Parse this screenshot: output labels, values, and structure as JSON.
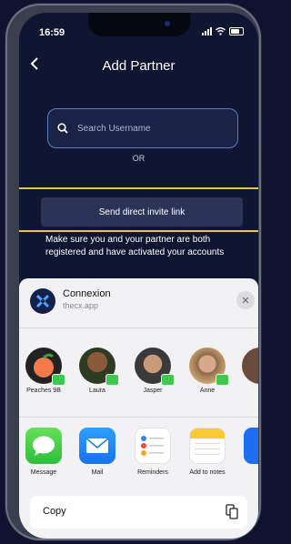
{
  "status": {
    "time": "16:59"
  },
  "header": {
    "title": "Add Partner"
  },
  "search": {
    "placeholder": "Search Username"
  },
  "divider_text": "OR",
  "invite": {
    "button_label": "Send direct invite link"
  },
  "info_text": "Make sure you and your partner are both registered and have activated your accounts",
  "share_sheet": {
    "app_name": "Connexion",
    "app_url": "thecx.app",
    "close_icon": "close-icon",
    "contacts": [
      {
        "name": "Peaches 9B",
        "icon": "peach-emoji-avatar"
      },
      {
        "name": "Laura",
        "icon": "contact-photo"
      },
      {
        "name": "Jasper",
        "icon": "contact-photo"
      },
      {
        "name": "Anne",
        "icon": "contact-photo"
      }
    ],
    "apps": [
      {
        "label": "Message",
        "icon": "messages-icon"
      },
      {
        "label": "Mail",
        "icon": "mail-icon"
      },
      {
        "label": "Reminders",
        "icon": "reminders-icon"
      },
      {
        "label": "Add to notes",
        "icon": "notes-icon"
      }
    ],
    "copy_label": "Copy"
  },
  "colors": {
    "background": "#0f1631",
    "highlight": "#f0c43a",
    "search_border": "#5d7bc4",
    "sheet": "#f2f2f4"
  }
}
